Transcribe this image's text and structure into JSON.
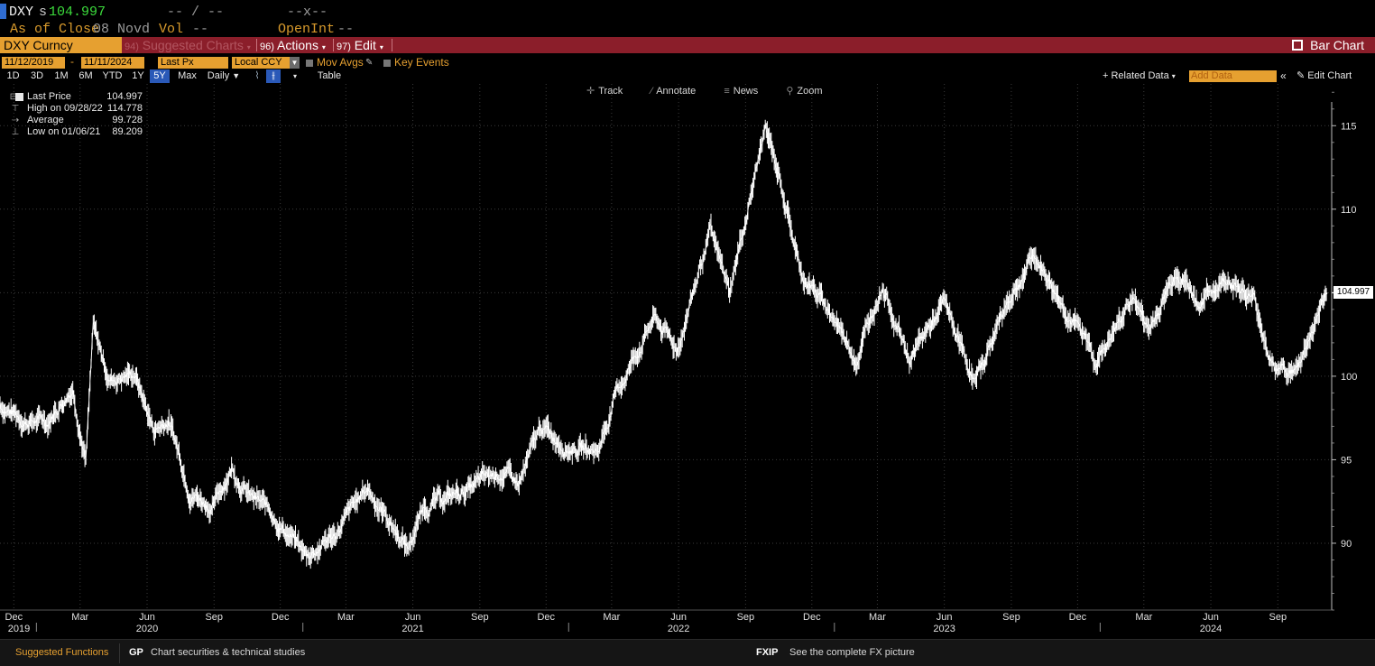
{
  "quote": {
    "ticker": "DXY",
    "source_flag": "s",
    "last_price": "104.997",
    "change": "-- / --",
    "range": "--x--",
    "as_of_label": "As of Close",
    "as_of_value": "08 Novd",
    "vol_label": "Vol",
    "vol_value": "--",
    "open_int_label": "OpenInt",
    "open_int_value": "--"
  },
  "function_bar": {
    "security": "DXY Curncy",
    "suggested_num": "94)",
    "suggested_label": "Suggested Charts",
    "actions_num": "96)",
    "actions_label": "Actions",
    "edit_num": "97)",
    "edit_label": "Edit",
    "bar_chart_label": "Bar Chart"
  },
  "params": {
    "start_date": "11/12/2019",
    "end_date": "11/11/2024",
    "date_sep": "-",
    "field": "Last Px",
    "currency": "Local CCY",
    "mov_avgs_label": "Mov Avgs",
    "key_events_label": "Key Events"
  },
  "periods": {
    "items": [
      "1D",
      "3D",
      "1M",
      "6M",
      "YTD",
      "1Y",
      "5Y",
      "Max"
    ],
    "active": "5Y",
    "frequency": "Daily",
    "table_label": "Table",
    "related_data_label": "+ Related Data",
    "add_data_placeholder": "Add Data",
    "edit_chart_label": "Edit Chart"
  },
  "toolbar": {
    "track": "Track",
    "annotate": "Annotate",
    "news": "News",
    "zoom": "Zoom"
  },
  "legend": {
    "last_price_label": "Last Price",
    "last_price_value": "104.997",
    "high_label": "High on 09/28/22",
    "high_value": "114.778",
    "average_label": "Average",
    "average_value": "99.728",
    "low_label": "Low on 01/06/21",
    "low_value": "89.209"
  },
  "footer": {
    "suggested_functions": "Suggested Functions",
    "gp_code": "GP",
    "gp_desc": "Chart securities & technical studies",
    "fxip_code": "FXIP",
    "fxip_desc": "See the complete FX picture"
  },
  "colors": {
    "background": "#000000",
    "accent_orange": "#e6a030",
    "function_bar_red": "#8b1e2a",
    "price_green": "#3cdc3c",
    "active_period_blue": "#2a59b8",
    "line": "#ffffff"
  },
  "chart_data": {
    "type": "line",
    "series": [
      {
        "name": "DXY Curncy",
        "x": [
          "2019-11-12",
          "2019-12-15",
          "2020-01-15",
          "2020-02-20",
          "2020-03-09",
          "2020-03-19",
          "2020-04-10",
          "2020-05-15",
          "2020-06-10",
          "2020-07-01",
          "2020-07-30",
          "2020-08-31",
          "2020-09-25",
          "2020-10-20",
          "2020-11-20",
          "2021-01-06",
          "2021-02-15",
          "2021-03-31",
          "2021-05-25",
          "2021-06-17",
          "2021-08-20",
          "2021-09-30",
          "2021-10-25",
          "2021-11-24",
          "2021-12-30",
          "2022-02-10",
          "2022-03-07",
          "2022-04-28",
          "2022-05-30",
          "2022-07-14",
          "2022-08-10",
          "2022-09-28",
          "2022-10-20",
          "2022-11-15",
          "2022-12-31",
          "2023-02-01",
          "2023-03-08",
          "2023-04-14",
          "2023-05-31",
          "2023-07-14",
          "2023-08-25",
          "2023-10-03",
          "2023-11-15",
          "2023-12-27",
          "2024-01-31",
          "2024-02-14",
          "2024-03-08",
          "2024-04-16",
          "2024-05-15",
          "2024-06-26",
          "2024-07-30",
          "2024-08-27",
          "2024-09-27",
          "2024-10-31",
          "2024-11-08"
        ],
        "values": [
          98.3,
          97.4,
          97.3,
          99.4,
          95.0,
          102.8,
          99.8,
          100.2,
          96.8,
          97.4,
          93.2,
          92.2,
          94.6,
          92.8,
          91.8,
          89.2,
          90.6,
          93.3,
          89.7,
          92.2,
          93.3,
          94.3,
          93.5,
          96.9,
          95.9,
          95.5,
          98.9,
          103.5,
          101.6,
          108.6,
          105.0,
          114.8,
          111.6,
          106.3,
          103.5,
          101.1,
          105.6,
          101.0,
          104.3,
          99.6,
          104.4,
          107.2,
          104.0,
          101.0,
          103.4,
          104.9,
          102.7,
          106.5,
          104.4,
          106.0,
          104.5,
          100.5,
          100.3,
          104.3,
          104.997
        ]
      }
    ],
    "x_tick_labels": [
      "Dec",
      "Mar",
      "Jun",
      "Sep",
      "Dec",
      "Mar",
      "Jun",
      "Sep",
      "Dec",
      "Mar",
      "Jun",
      "Sep",
      "Dec",
      "Mar",
      "Jun",
      "Sep",
      "Dec",
      "Mar",
      "Jun",
      "Sep"
    ],
    "x_tick_dates": [
      "2019-12-01",
      "2020-03-01",
      "2020-06-01",
      "2020-09-01",
      "2020-12-01",
      "2021-03-01",
      "2021-06-01",
      "2021-09-01",
      "2021-12-01",
      "2022-03-01",
      "2022-06-01",
      "2022-09-01",
      "2022-12-01",
      "2023-03-01",
      "2023-06-01",
      "2023-09-01",
      "2023-12-01",
      "2024-03-01",
      "2024-06-01",
      "2024-09-01"
    ],
    "year_labels": [
      "2019",
      "2020",
      "2021",
      "2022",
      "2023",
      "2024"
    ],
    "year_dates": [
      "2019-12-01",
      "2020-06-01",
      "2021-06-01",
      "2022-06-01",
      "2023-06-01",
      "2024-06-01"
    ],
    "y_ticks": [
      90,
      95,
      100,
      105,
      110,
      115
    ],
    "y_tick_labels": [
      "90",
      "95",
      "100",
      "",
      "110",
      "115"
    ],
    "ylim": [
      86.0,
      117.5
    ],
    "xlim": [
      "2019-11-12",
      "2024-11-14"
    ],
    "last_value_label": "104.997",
    "grid": true,
    "legend_position": "top-left"
  }
}
